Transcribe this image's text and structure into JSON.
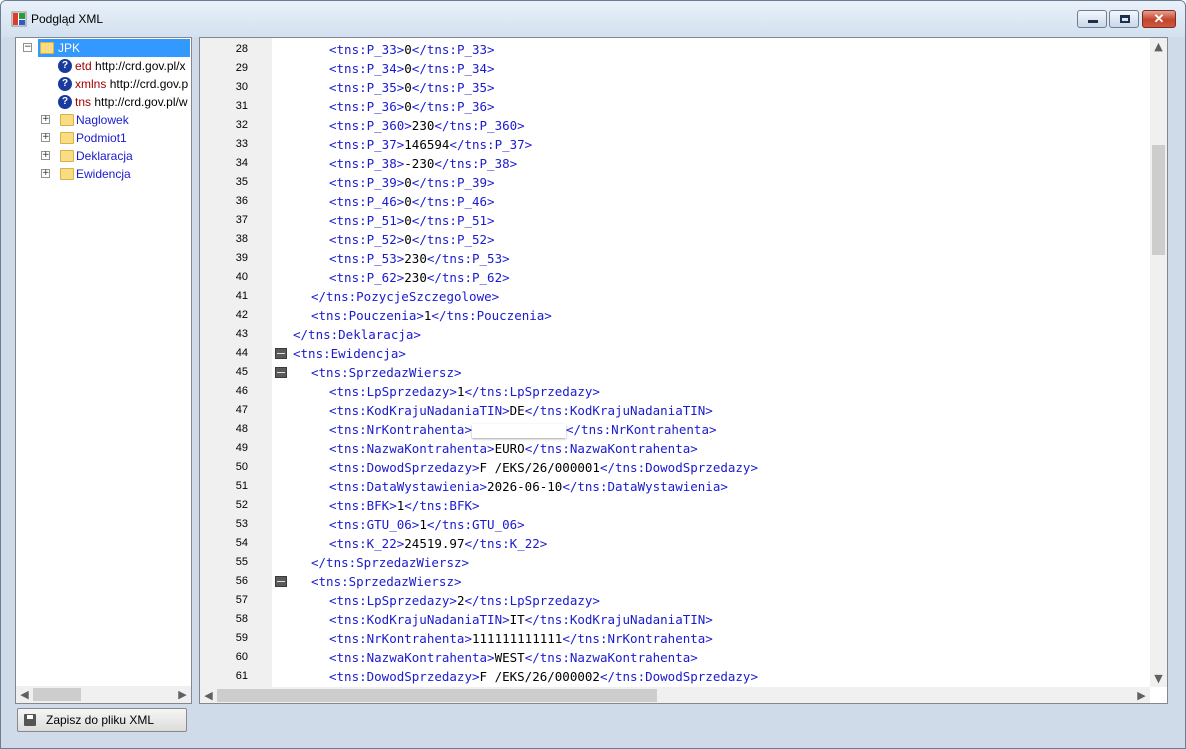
{
  "window": {
    "title": "Podgląd XML"
  },
  "tree": {
    "root": {
      "label": "JPK"
    },
    "attributes": [
      {
        "name": "etd",
        "value": "http://crd.gov.pl/x"
      },
      {
        "name": "xmlns",
        "value": "http://crd.gov.p"
      },
      {
        "name": "tns",
        "value": "http://crd.gov.pl/w"
      }
    ],
    "nodes": [
      {
        "label": "Naglowek"
      },
      {
        "label": "Podmiot1"
      },
      {
        "label": "Deklaracja"
      },
      {
        "label": "Ewidencja"
      }
    ]
  },
  "editor": {
    "lines": [
      {
        "n": "28",
        "indent": 3,
        "tag": "tns:P_33",
        "value": "0"
      },
      {
        "n": "29",
        "indent": 3,
        "tag": "tns:P_34",
        "value": "0"
      },
      {
        "n": "30",
        "indent": 3,
        "tag": "tns:P_35",
        "value": "0"
      },
      {
        "n": "31",
        "indent": 3,
        "tag": "tns:P_36",
        "value": "0"
      },
      {
        "n": "32",
        "indent": 3,
        "tag": "tns:P_360",
        "value": "230"
      },
      {
        "n": "33",
        "indent": 3,
        "tag": "tns:P_37",
        "value": "146594"
      },
      {
        "n": "34",
        "indent": 3,
        "tag": "tns:P_38",
        "value": "-230"
      },
      {
        "n": "35",
        "indent": 3,
        "tag": "tns:P_39",
        "value": "0"
      },
      {
        "n": "36",
        "indent": 3,
        "tag": "tns:P_46",
        "value": "0"
      },
      {
        "n": "37",
        "indent": 3,
        "tag": "tns:P_51",
        "value": "0"
      },
      {
        "n": "38",
        "indent": 3,
        "tag": "tns:P_52",
        "value": "0"
      },
      {
        "n": "39",
        "indent": 3,
        "tag": "tns:P_53",
        "value": "230"
      },
      {
        "n": "40",
        "indent": 3,
        "tag": "tns:P_62",
        "value": "230"
      },
      {
        "n": "41",
        "indent": 2,
        "kind": "close",
        "tag": "tns:PozycjeSzczegolowe"
      },
      {
        "n": "42",
        "indent": 2,
        "tag": "tns:Pouczenia",
        "value": "1"
      },
      {
        "n": "43",
        "indent": 1,
        "kind": "close",
        "tag": "tns:Deklaracja"
      },
      {
        "n": "44",
        "indent": 1,
        "kind": "open",
        "tag": "tns:Ewidencja",
        "fold": true
      },
      {
        "n": "45",
        "indent": 2,
        "kind": "open",
        "tag": "tns:SprzedazWiersz",
        "fold": true
      },
      {
        "n": "46",
        "indent": 3,
        "tag": "tns:LpSprzedazy",
        "value": "1"
      },
      {
        "n": "47",
        "indent": 3,
        "tag": "tns:KodKrajuNadaniaTIN",
        "value": "DE"
      },
      {
        "n": "48",
        "indent": 3,
        "tag": "tns:NrKontrahenta",
        "value": "",
        "redacted": true
      },
      {
        "n": "49",
        "indent": 3,
        "tag": "tns:NazwaKontrahenta",
        "value": "EURO"
      },
      {
        "n": "50",
        "indent": 3,
        "tag": "tns:DowodSprzedazy",
        "value": "F /EKS/26/000001"
      },
      {
        "n": "51",
        "indent": 3,
        "tag": "tns:DataWystawienia",
        "value": "2026-06-10"
      },
      {
        "n": "52",
        "indent": 3,
        "tag": "tns:BFK",
        "value": "1"
      },
      {
        "n": "53",
        "indent": 3,
        "tag": "tns:GTU_06",
        "value": "1"
      },
      {
        "n": "54",
        "indent": 3,
        "tag": "tns:K_22",
        "value": "24519.97"
      },
      {
        "n": "55",
        "indent": 2,
        "kind": "close",
        "tag": "tns:SprzedazWiersz"
      },
      {
        "n": "56",
        "indent": 2,
        "kind": "open",
        "tag": "tns:SprzedazWiersz",
        "fold": true
      },
      {
        "n": "57",
        "indent": 3,
        "tag": "tns:LpSprzedazy",
        "value": "2"
      },
      {
        "n": "58",
        "indent": 3,
        "tag": "tns:KodKrajuNadaniaTIN",
        "value": "IT"
      },
      {
        "n": "59",
        "indent": 3,
        "tag": "tns:NrKontrahenta",
        "value": "111111111111"
      },
      {
        "n": "60",
        "indent": 3,
        "tag": "tns:NazwaKontrahenta",
        "value": "WEST"
      },
      {
        "n": "61",
        "indent": 3,
        "tag": "tns:DowodSprzedazy",
        "value": "F /EKS/26/000002"
      }
    ]
  },
  "footer": {
    "save_label": "Zapisz do pliku XML"
  },
  "icons": {
    "tree_collapse": "minus-box-icon",
    "tree_expand": "plus-box-icon",
    "folder": "folder-icon",
    "attribute": "question-circle-icon",
    "fold": "fold-collapse-icon",
    "save": "floppy-disk-icon",
    "arrows": {
      "left": "◀",
      "right": "▶",
      "up": "▲",
      "down": "▼"
    }
  },
  "colors": {
    "tag": "#1a1ad0",
    "attr_name": "#a00000",
    "selection": "#3399ff",
    "chrome": "#cfdbe9"
  }
}
